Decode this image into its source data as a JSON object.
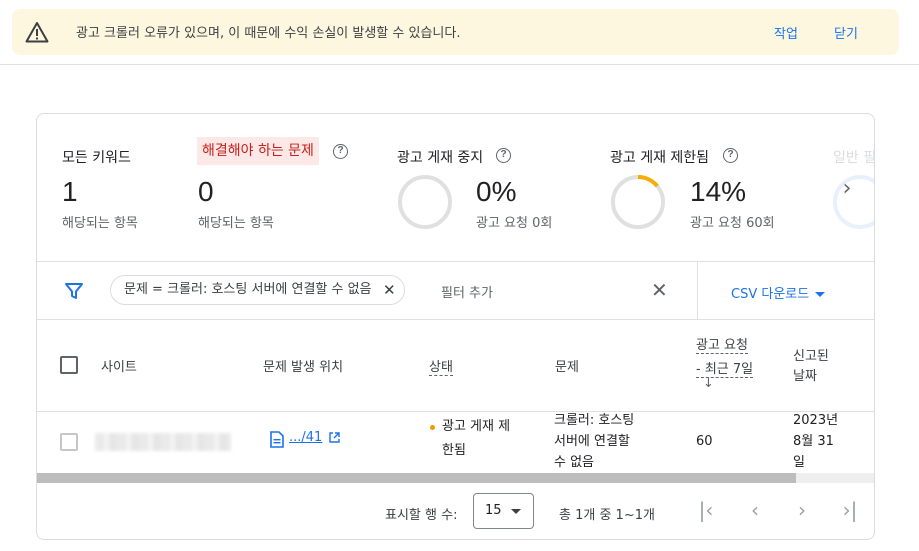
{
  "alert": {
    "message": "광고 크롤러 오류가 있으며, 이 때문에 수익 손실이 발생할 수 있습니다.",
    "action_label": "작업",
    "dismiss_label": "닫기"
  },
  "metrics": [
    {
      "title": "모든 키워드",
      "value": "1",
      "sub": "해당되는 항목"
    },
    {
      "title": "해결해야 하는 문제",
      "value": "0",
      "sub": "해당되는 항목"
    },
    {
      "title": "광고 게재 중지",
      "value": "0%",
      "sub": "광고 요청 0회",
      "fraction": 0
    },
    {
      "title": "광고 게재 제한됨",
      "value": "14%",
      "sub": "광고 요청 60회",
      "fraction": 0.14
    },
    {
      "title": "일반 필"
    }
  ],
  "colors": {
    "accent": "#1a73e8",
    "warning": "#f29900",
    "error": "#c5221f",
    "chip_bg": "#fce8e6",
    "alert_bg": "#fef7e0"
  },
  "filter": {
    "chip_text": "문제 = 크롤러: 호스팅 서버에 연결할 수 없음",
    "add_placeholder": "필터 추가",
    "csv_label": "CSV 다운로드"
  },
  "table": {
    "headers": {
      "site": "사이트",
      "location": "문제 발생 위치",
      "status": "상태",
      "issue": "문제",
      "requests_line1": "광고 요청",
      "requests_line2": "- 최근 7일",
      "reported_line1": "신고된",
      "reported_line2": "날짜"
    },
    "rows": [
      {
        "location_link": ".../41",
        "status_line1": "광고 게재 제",
        "status_line2": "한됨",
        "issue_line1": "크롤러: 호스팅",
        "issue_line2": "서버에 연결할",
        "issue_line3": "수 없음",
        "requests": "60",
        "date_line1": "2023년",
        "date_line2": "8월 31",
        "date_line3": "일"
      }
    ]
  },
  "pagination": {
    "rows_label": "표시할 행 수:",
    "rows_value": "15",
    "range": "총 1개 중 1~1개"
  }
}
